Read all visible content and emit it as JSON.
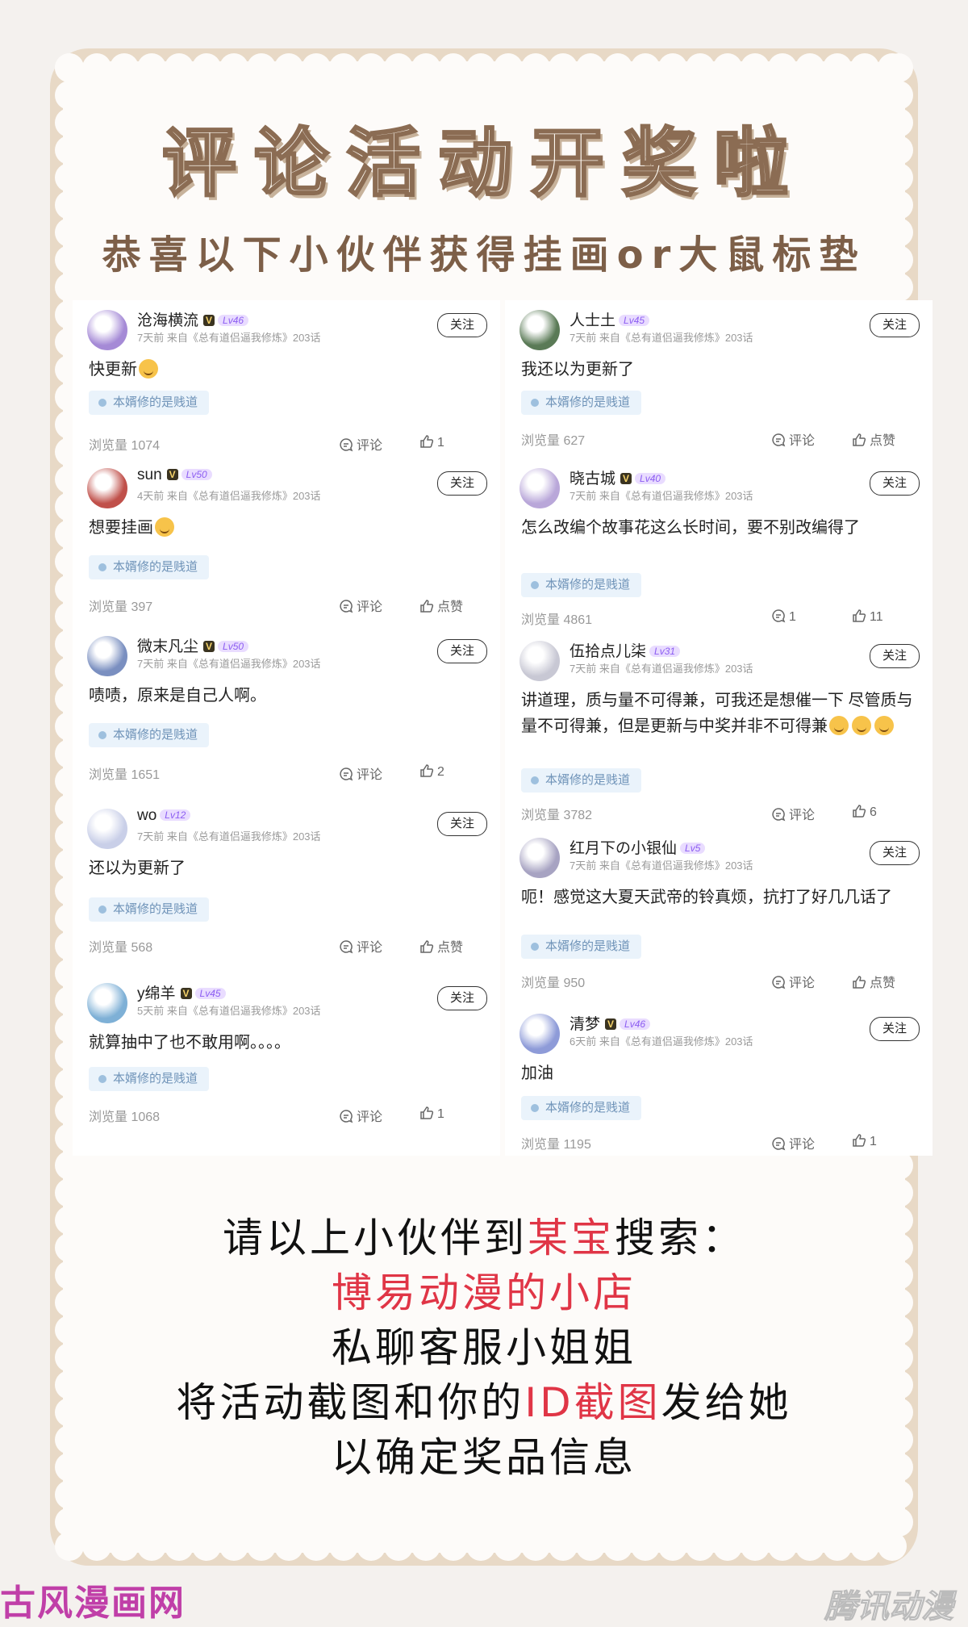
{
  "header": {
    "title": "评论活动开奖啦",
    "subtitle": "恭喜以下小伙伴获得挂画or大鼠标垫"
  },
  "common": {
    "follow_label": "关注",
    "comment_label": "评论",
    "like_label": "点赞",
    "tag_label": "本婿修的是贱道",
    "source": "来自《总有道侣逼我修炼》203话"
  },
  "left_comments": [
    {
      "name": "沧海横流",
      "vbadge": "V",
      "level": "Lv46",
      "time": "7天前",
      "text": "快更新",
      "views": "浏览量 1074",
      "comments": "评论",
      "likes": "1",
      "avatar_color": "#a58ad6"
    },
    {
      "name": "sun",
      "vbadge": "V",
      "level": "Lv50",
      "time": "4天前",
      "text": "想要挂画",
      "views": "浏览量 397",
      "comments": "评论",
      "likes": "点赞",
      "avatar_color": "#c0504a"
    },
    {
      "name": "微末凡尘",
      "vbadge": "V",
      "level": "Lv50",
      "time": "7天前",
      "text": "啧啧，原来是自己人啊。",
      "views": "浏览量 1651",
      "comments": "评论",
      "likes": "2",
      "avatar_color": "#7a8fc0"
    },
    {
      "name": "wo",
      "vbadge": "",
      "level": "Lv12",
      "time": "7天前",
      "text": "还以为更新了",
      "views": "浏览量 568",
      "comments": "评论",
      "likes": "点赞",
      "avatar_color": "#c9cfe8"
    },
    {
      "name": "y绵羊",
      "vbadge": "V",
      "level": "Lv45",
      "time": "5天前",
      "text": "就算抽中了也不敢用啊。。。。",
      "views": "浏览量 1068",
      "comments": "评论",
      "likes": "1",
      "avatar_color": "#7eb0d6"
    }
  ],
  "right_comments": [
    {
      "name": "人士土",
      "vbadge": "",
      "level": "Lv45",
      "time": "7天前",
      "text": "我还以为更新了",
      "views": "浏览量 627",
      "comments": "评论",
      "likes": "点赞",
      "avatar_color": "#5a7a56"
    },
    {
      "name": "晓古城",
      "vbadge": "V",
      "level": "Lv40",
      "time": "7天前",
      "text": "怎么改编个故事花这么长时间，要不别改编得了",
      "views": "浏览量 4861",
      "comments": "1",
      "likes": "11",
      "avatar_color": "#b9a7d9"
    },
    {
      "name": "伍拾点儿柒",
      "vbadge": "",
      "level": "Lv31",
      "time": "7天前",
      "text": "讲道理，质与量不可得兼，可我还是想催一下 尽管质与量不可得兼，但是更新与中奖并非不可得兼",
      "views": "浏览量 3782",
      "comments": "评论",
      "likes": "6",
      "avatar_color": "#c8c8d4"
    },
    {
      "name": "红月下の小银仙",
      "vbadge": "",
      "level": "Lv5",
      "time": "7天前",
      "text": "呃！感觉这大夏天武帝的铃真烦，抗打了好几几话了",
      "views": "浏览量 950",
      "comments": "评论",
      "likes": "点赞",
      "avatar_color": "#a7a3c2"
    },
    {
      "name": "清梦",
      "vbadge": "V",
      "level": "Lv46",
      "time": "6天前",
      "text": "加油",
      "views": "浏览量 1195",
      "comments": "评论",
      "likes": "1",
      "avatar_color": "#8e9bd8"
    }
  ],
  "bottom": {
    "line1_a": "请以上小伙伴到",
    "line1_red": "某宝",
    "line1_b": "搜索：",
    "line2_red": "博易动漫的小店",
    "line3": "私聊客服小姐姐",
    "line4_a": "将活动截图和你的",
    "line4_red": "ID截图",
    "line4_b": "发给她",
    "line5": "以确定奖品信息"
  },
  "watermarks": {
    "left": "古风漫画网",
    "right": "腾讯动漫"
  }
}
